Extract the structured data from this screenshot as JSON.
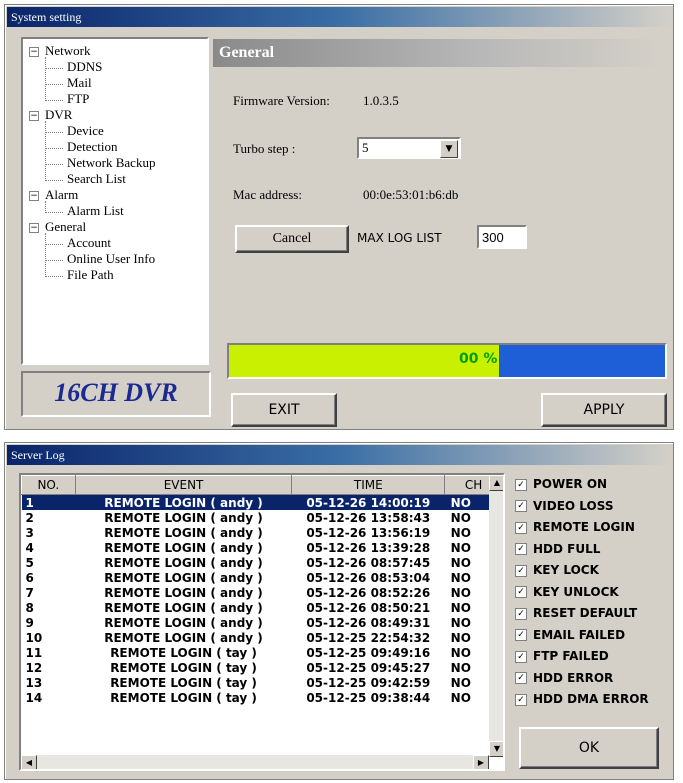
{
  "system_window": {
    "title": "System setting",
    "tree": [
      {
        "label": "Network",
        "level": 0,
        "toggle": "−"
      },
      {
        "label": "DDNS",
        "level": 1
      },
      {
        "label": "Mail",
        "level": 1
      },
      {
        "label": "FTP",
        "level": 1
      },
      {
        "label": "DVR",
        "level": 0,
        "toggle": "−"
      },
      {
        "label": "Device",
        "level": 1
      },
      {
        "label": "Detection",
        "level": 1
      },
      {
        "label": "Network Backup",
        "level": 1
      },
      {
        "label": "Search List",
        "level": 1
      },
      {
        "label": "Alarm",
        "level": 0,
        "toggle": "−"
      },
      {
        "label": "Alarm List",
        "level": 1
      },
      {
        "label": "General",
        "level": 0,
        "toggle": "−"
      },
      {
        "label": "Account",
        "level": 1
      },
      {
        "label": "Online User Info",
        "level": 1
      },
      {
        "label": "File Path",
        "level": 1
      }
    ],
    "brand": "16CH DVR",
    "section_title": "General",
    "firmware_label": "Firmware Version:",
    "firmware_value": "1.0.3.5",
    "turbo_label": "Turbo step :",
    "turbo_value": "5",
    "mac_label": "Mac address:",
    "mac_value": "00:0e:53:01:b6:db",
    "cancel_label": "Cancel",
    "max_log_label": "MAX LOG LIST",
    "max_log_value": "300",
    "progress_text": "00 %",
    "progress_fraction": 0.62,
    "exit_label": "EXIT",
    "apply_label": "APPLY",
    "colors": {
      "progress_fill": "#c8f000",
      "progress_bg": "#1e5fd8",
      "progress_text": "#00a000",
      "brand": "#1a2a90"
    }
  },
  "log_window": {
    "title": "Server Log",
    "columns": [
      "NO.",
      "EVENT",
      "TIME",
      "CH"
    ],
    "rows": [
      {
        "no": "1",
        "event": "REMOTE LOGIN ( andy )",
        "time": "05-12-26 14:00:19",
        "ch": "NO"
      },
      {
        "no": "2",
        "event": "REMOTE LOGIN ( andy )",
        "time": "05-12-26 13:58:43",
        "ch": "NO"
      },
      {
        "no": "3",
        "event": "REMOTE LOGIN ( andy )",
        "time": "05-12-26 13:56:19",
        "ch": "NO"
      },
      {
        "no": "4",
        "event": "REMOTE LOGIN ( andy )",
        "time": "05-12-26 13:39:28",
        "ch": "NO"
      },
      {
        "no": "5",
        "event": "REMOTE LOGIN ( andy )",
        "time": "05-12-26 08:57:45",
        "ch": "NO"
      },
      {
        "no": "6",
        "event": "REMOTE LOGIN ( andy )",
        "time": "05-12-26 08:53:04",
        "ch": "NO"
      },
      {
        "no": "7",
        "event": "REMOTE LOGIN ( andy )",
        "time": "05-12-26 08:52:26",
        "ch": "NO"
      },
      {
        "no": "8",
        "event": "REMOTE LOGIN ( andy )",
        "time": "05-12-26 08:50:21",
        "ch": "NO"
      },
      {
        "no": "9",
        "event": "REMOTE LOGIN ( andy )",
        "time": "05-12-26 08:49:31",
        "ch": "NO"
      },
      {
        "no": "10",
        "event": "REMOTE LOGIN ( andy )",
        "time": "05-12-25 22:54:32",
        "ch": "NO"
      },
      {
        "no": "11",
        "event": "REMOTE LOGIN ( tay )",
        "time": "05-12-25 09:49:16",
        "ch": "NO"
      },
      {
        "no": "12",
        "event": "REMOTE LOGIN ( tay )",
        "time": "05-12-25 09:45:27",
        "ch": "NO"
      },
      {
        "no": "13",
        "event": "REMOTE LOGIN ( tay )",
        "time": "05-12-25 09:42:59",
        "ch": "NO"
      },
      {
        "no": "14",
        "event": "REMOTE LOGIN ( tay )",
        "time": "05-12-25 09:38:44",
        "ch": "NO"
      }
    ],
    "filters": [
      "POWER ON",
      "VIDEO LOSS",
      "REMOTE LOGIN",
      "HDD FULL",
      "KEY LOCK",
      "KEY UNLOCK",
      "RESET DEFAULT",
      "EMAIL FAILED",
      "FTP FAILED",
      "HDD ERROR",
      "HDD DMA ERROR"
    ],
    "check_mark": "✓",
    "ok_label": "OK"
  }
}
